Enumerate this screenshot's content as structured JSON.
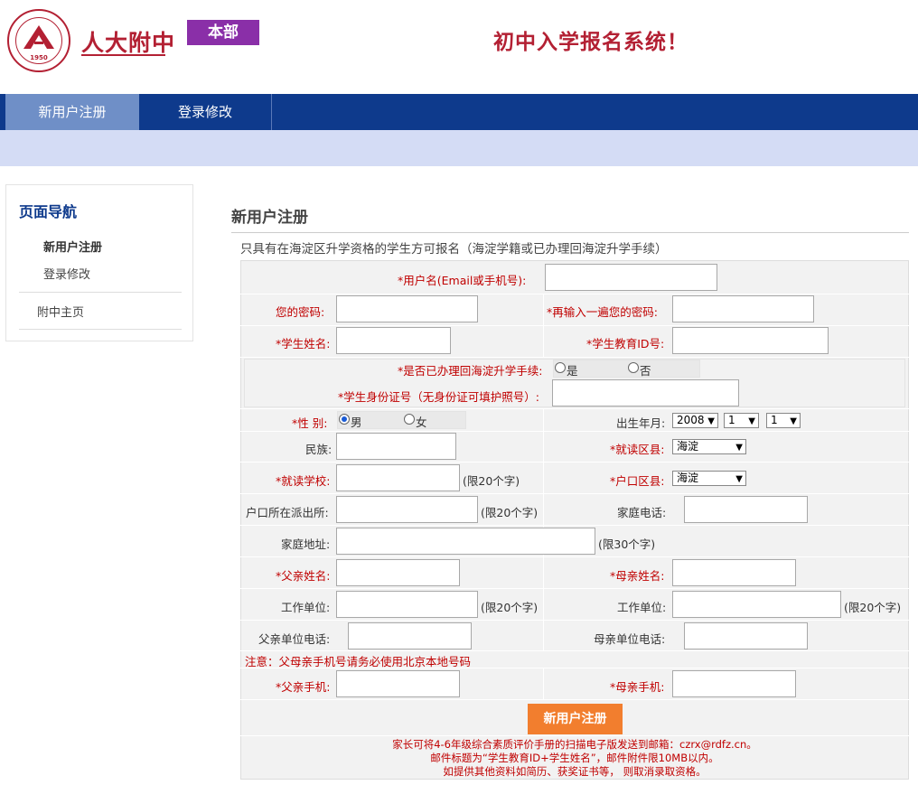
{
  "header": {
    "logo_year": "1950",
    "school_name": "人大附中",
    "campus_badge": "本部",
    "system_title": "初中入学报名系统！",
    "brand_color": "#b32033"
  },
  "nav": {
    "tabs": [
      {
        "label": "新用户注册",
        "active": true
      },
      {
        "label": "登录修改",
        "active": false
      }
    ]
  },
  "sidebar": {
    "title": "页面导航",
    "items": [
      "新用户注册",
      "登录修改",
      "附中主页"
    ]
  },
  "main": {
    "title": "新用户注册",
    "notice": "只具有在海淀区升学资格的学生方可报名（海淀学籍或已办理回海淀升学手续）"
  },
  "form": {
    "username_label": "*用户名(Email或手机号):",
    "password_label": "您的密码:",
    "password2_label": "*再输入一遍您的密码:",
    "student_name_label": "*学生姓名:",
    "student_id_label": "*学生教育ID号:",
    "transfer_label": "*是否已办理回海淀升学手续:",
    "transfer_yes": "是",
    "transfer_no": "否",
    "idcard_label": "*学生身份证号（无身份证可填护照号）:",
    "gender_label": "*性  别:",
    "gender_male": "男",
    "gender_female": "女",
    "birth_label": "出生年月:",
    "birth_year": "2008",
    "birth_month": "1",
    "birth_day": "1",
    "ethnicity_label": "民族:",
    "district_label": "*就读区县:",
    "district_value": "海淀",
    "school_label": "*就读学校:",
    "school_hint": "(限20个字)",
    "hukou_district_label": "*户口区县:",
    "hukou_district_value": "海淀",
    "police_label": "户口所在派出所:",
    "police_hint": "(限20个字)",
    "home_phone_label": "家庭电话:",
    "address_label": "家庭地址:",
    "address_hint": "(限30个字)",
    "father_name_label": "*父亲姓名:",
    "mother_name_label": "*母亲姓名:",
    "father_work_label": "工作单位:",
    "father_work_hint": "(限20个字)",
    "mother_work_label": "工作单位:",
    "mother_work_hint": "(限20个字)",
    "father_work_phone_label": "父亲单位电话:",
    "mother_work_phone_label": "母亲单位电话:",
    "phone_warning": "注意：父母亲手机号请务必使用北京本地号码",
    "father_mobile_label": "*父亲手机:",
    "mother_mobile_label": "*母亲手机:",
    "submit_label": "新用户注册",
    "footer_lines": [
      "家长可将4-6年级综合素质评价手册的扫描电子版发送到邮箱：czrx@rdfz.cn。",
      "邮件标题为“学生教育ID+学生姓名”，邮件附件限10MB以内。",
      "如提供其他资料如简历、获奖证书等， 则取消录取资格。"
    ]
  }
}
